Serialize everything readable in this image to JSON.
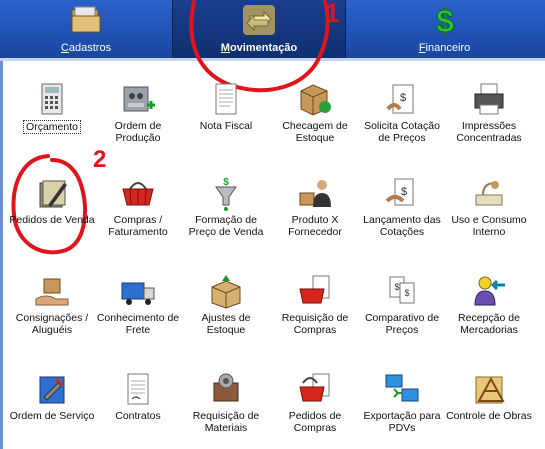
{
  "tabs": [
    {
      "label": "Cadastros",
      "icon": "folder-icon"
    },
    {
      "label": "Movimentação",
      "icon": "exchange-arrows-icon"
    },
    {
      "label": "Financeiro",
      "icon": "dollar-icon"
    }
  ],
  "annotations": {
    "one": "1",
    "two": "2"
  },
  "modules": [
    {
      "label": "Orçamento",
      "icon": "calculator-icon"
    },
    {
      "label": "Ordem de Produção",
      "icon": "production-machine-icon"
    },
    {
      "label": "Nota Fiscal",
      "icon": "invoice-icon"
    },
    {
      "label": "Checagem de Estoque",
      "icon": "box-check-icon"
    },
    {
      "label": "Solicita Cotação de Preços",
      "icon": "price-quote-icon"
    },
    {
      "label": "Impressões Concentradas",
      "icon": "printer-icon"
    },
    {
      "label": "Pedidos de Venda",
      "icon": "notebook-pen-icon"
    },
    {
      "label": "Compras / Faturamento",
      "icon": "shopping-basket-icon"
    },
    {
      "label": "Formação de Preço de Venda",
      "icon": "funnel-dollar-icon"
    },
    {
      "label": "Produto X Fornecedor",
      "icon": "supplier-person-icon"
    },
    {
      "label": "Lançamento das Cotações",
      "icon": "quote-entry-icon"
    },
    {
      "label": "Uso e Consumo Interno",
      "icon": "internal-consumption-icon"
    },
    {
      "label": "Consignações / Aluguéis",
      "icon": "hand-box-icon"
    },
    {
      "label": "Conhecimento de Frete",
      "icon": "truck-icon"
    },
    {
      "label": "Ajustes de Estoque",
      "icon": "box-adjust-icon"
    },
    {
      "label": "Requisição de Compras",
      "icon": "purchase-request-icon"
    },
    {
      "label": "Comparativo de Preços",
      "icon": "price-compare-icon"
    },
    {
      "label": "Recepção de Mercadorias",
      "icon": "goods-reception-icon"
    },
    {
      "label": "Ordem de Serviço",
      "icon": "service-order-icon"
    },
    {
      "label": "Contratos",
      "icon": "contract-icon"
    },
    {
      "label": "Requisição de Materiais",
      "icon": "materials-request-icon"
    },
    {
      "label": "Pedidos de Compras",
      "icon": "purchase-order-icon"
    },
    {
      "label": "Exportação para PDVs",
      "icon": "pdv-export-icon"
    },
    {
      "label": "Controle de Obras",
      "icon": "construction-icon"
    }
  ]
}
